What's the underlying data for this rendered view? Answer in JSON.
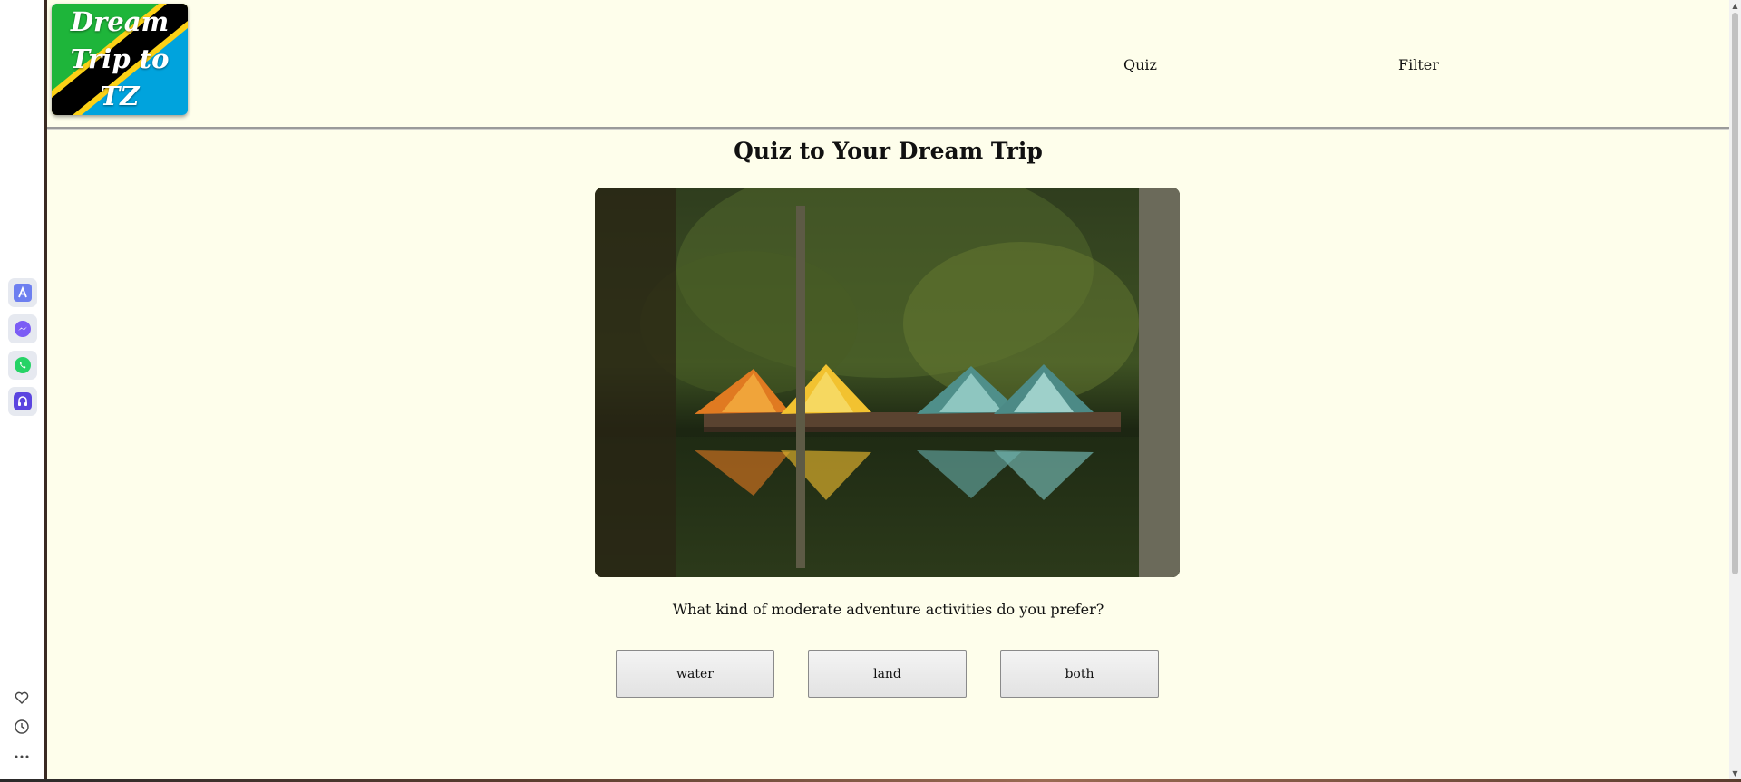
{
  "site": {
    "logo_text": "Dream Trip to TZ",
    "nav": {
      "quiz_label": "Quiz",
      "filter_label": "Filter"
    }
  },
  "quiz": {
    "title": "Quiz to Your Dream Trip",
    "question": "What kind of moderate adventure activities do you prefer?",
    "answers": [
      "water",
      "land",
      "both"
    ]
  },
  "browser_dock": {
    "icons": [
      "app-store-icon",
      "messenger-icon",
      "whatsapp-icon",
      "music-icon",
      "heart-icon",
      "history-icon",
      "more-icon"
    ]
  },
  "colors": {
    "page_bg": "#fefeeb",
    "flag_green": "#1eb53a",
    "flag_blue": "#00a3dd",
    "flag_yellow": "#fcd116"
  }
}
